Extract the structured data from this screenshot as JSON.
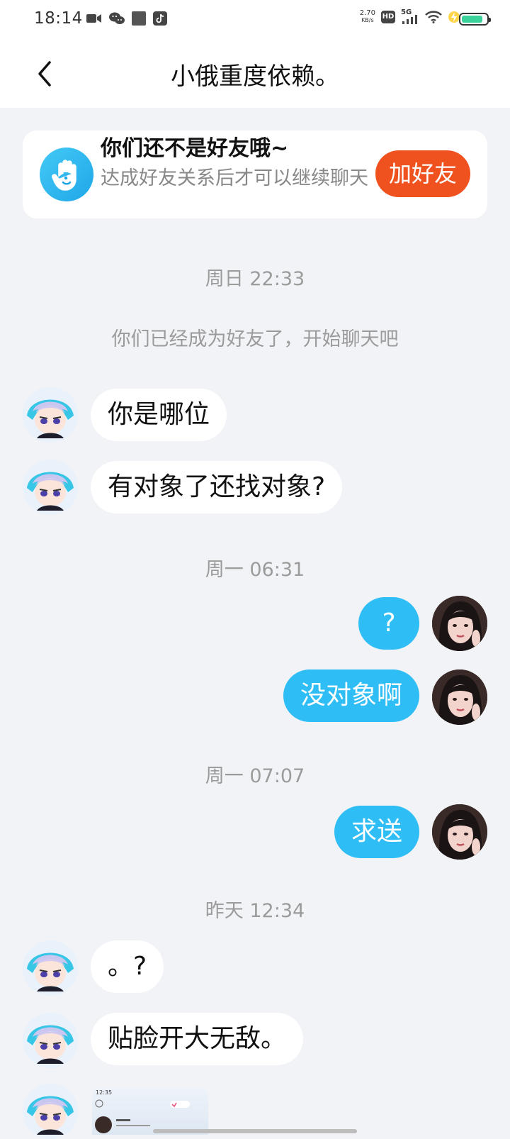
{
  "status_bar": {
    "time": "18:14",
    "net_speed_value": "2.70",
    "net_speed_unit": "KB/s",
    "hd_label": "HD",
    "network": "5G",
    "battery_fill": 0.85,
    "battery_color": "#3bd19a"
  },
  "header": {
    "title": "小俄重度依赖。"
  },
  "friend_card": {
    "title": "你们还不是好友哦~",
    "subtitle": "达成好友关系后才可以继续聊天",
    "add_button": "加好友",
    "accent": "#f0521f"
  },
  "conversation": {
    "stamps": [
      "周日 22:33",
      "周一 06:31",
      "周一 07:07",
      "昨天 12:34"
    ],
    "system_notice": "你们已经成为好友了，开始聊天吧",
    "messages": [
      {
        "from": "other",
        "text": "你是哪位"
      },
      {
        "from": "other",
        "text": "有对象了还找对象?"
      },
      {
        "from": "me",
        "text": "?"
      },
      {
        "from": "me",
        "text": "没对象啊"
      },
      {
        "from": "me",
        "text": "求送"
      },
      {
        "from": "other",
        "text": "。?"
      },
      {
        "from": "other",
        "text": "贴脸开大无敌。"
      }
    ],
    "image_message": {
      "time": "12:35"
    },
    "bubble_color_me": "#2fbdf5"
  }
}
